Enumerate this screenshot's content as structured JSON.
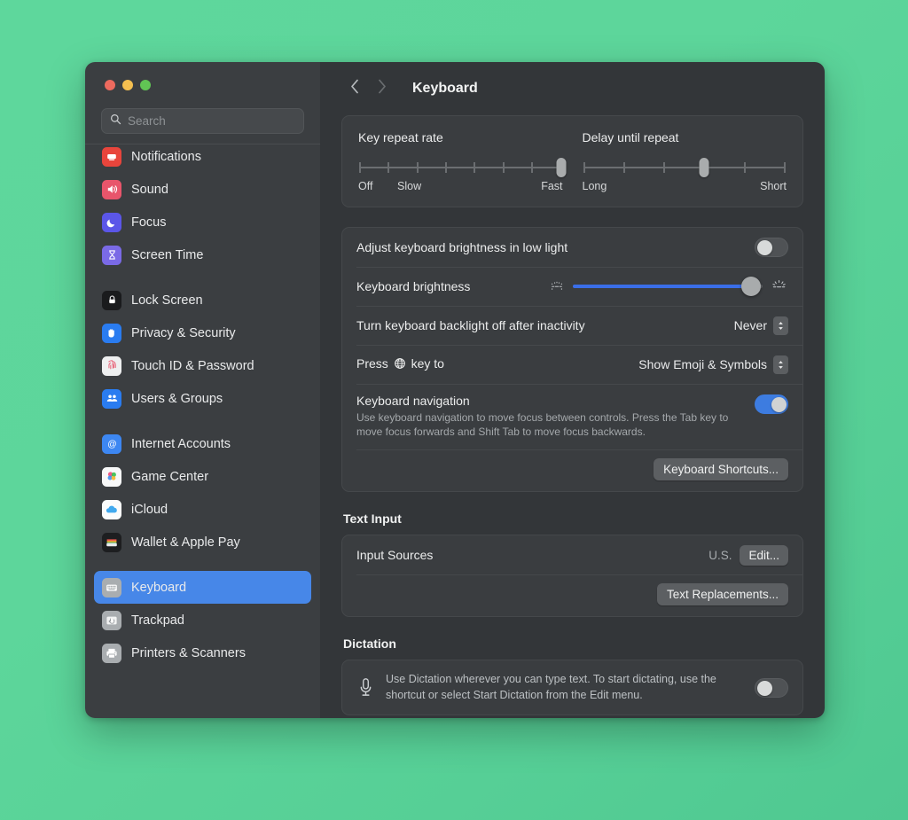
{
  "window": {
    "traffic_lights": [
      "close",
      "minimize",
      "zoom"
    ]
  },
  "sidebar": {
    "search": {
      "placeholder": "Search",
      "value": ""
    },
    "items": [
      {
        "label": "Notifications",
        "icon": "notifications-icon",
        "clipped": true
      },
      {
        "label": "Sound",
        "icon": "sound-icon"
      },
      {
        "label": "Focus",
        "icon": "focus-icon"
      },
      {
        "label": "Screen Time",
        "icon": "screen-time-icon"
      },
      {
        "label": "Lock Screen",
        "icon": "lock-screen-icon",
        "group_start": true
      },
      {
        "label": "Privacy & Security",
        "icon": "privacy-security-icon"
      },
      {
        "label": "Touch ID & Password",
        "icon": "touch-id-icon"
      },
      {
        "label": "Users & Groups",
        "icon": "users-groups-icon"
      },
      {
        "label": "Internet Accounts",
        "icon": "internet-accounts-icon",
        "group_start": true
      },
      {
        "label": "Game Center",
        "icon": "game-center-icon"
      },
      {
        "label": "iCloud",
        "icon": "icloud-icon"
      },
      {
        "label": "Wallet & Apple Pay",
        "icon": "wallet-icon"
      },
      {
        "label": "Keyboard",
        "icon": "keyboard-icon",
        "group_start": true,
        "selected": true
      },
      {
        "label": "Trackpad",
        "icon": "trackpad-icon"
      },
      {
        "label": "Printers & Scanners",
        "icon": "printers-scanners-icon"
      }
    ]
  },
  "toolbar": {
    "back_icon": "chevron-left-icon",
    "forward_icon": "chevron-right-icon",
    "title": "Keyboard"
  },
  "main": {
    "key_repeat": {
      "title": "Key repeat rate",
      "ticks": 8,
      "value_index": 8,
      "label_left": "Off",
      "label_mid": "Slow",
      "label_right": "Fast"
    },
    "delay_repeat": {
      "title": "Delay until repeat",
      "ticks": 6,
      "value_index": 4,
      "label_left": "Long",
      "label_right": "Short"
    },
    "adjust_brightness": {
      "label": "Adjust keyboard brightness in low light",
      "enabled": false
    },
    "keyboard_brightness": {
      "label": "Keyboard brightness",
      "value_percent": 94,
      "icon_low": "brightness-low-icon",
      "icon_high": "brightness-high-icon"
    },
    "backlight_off": {
      "label": "Turn keyboard backlight off after inactivity",
      "value": "Never",
      "stepper_icon": "chevron-updown-icon"
    },
    "globe_key": {
      "label_before": "Press",
      "key_icon": "globe-icon",
      "label_after": "key to",
      "value": "Show Emoji & Symbols",
      "stepper_icon": "chevron-updown-icon"
    },
    "keyboard_navigation": {
      "title": "Keyboard navigation",
      "description": "Use keyboard navigation to move focus between controls. Press the Tab key to move focus forwards and Shift Tab to move focus backwards.",
      "enabled": true
    },
    "keyboard_shortcuts_button": "Keyboard Shortcuts...",
    "text_input": {
      "heading": "Text Input",
      "input_sources_label": "Input Sources",
      "input_sources_value": "U.S.",
      "edit_button": "Edit...",
      "text_replacements_button": "Text Replacements..."
    },
    "dictation": {
      "heading": "Dictation",
      "icon": "microphone-icon",
      "description": "Use Dictation wherever you can type text. To start dictating, use the shortcut or select Start Dictation from the Edit menu.",
      "enabled": false
    }
  },
  "colors": {
    "accent": "#3d7ce0",
    "selection": "#4787e8",
    "window_bg": "#333639",
    "sidebar_bg": "#3b3e41",
    "card_bg": "#3a3d40",
    "desktop": "#5dd69b"
  }
}
